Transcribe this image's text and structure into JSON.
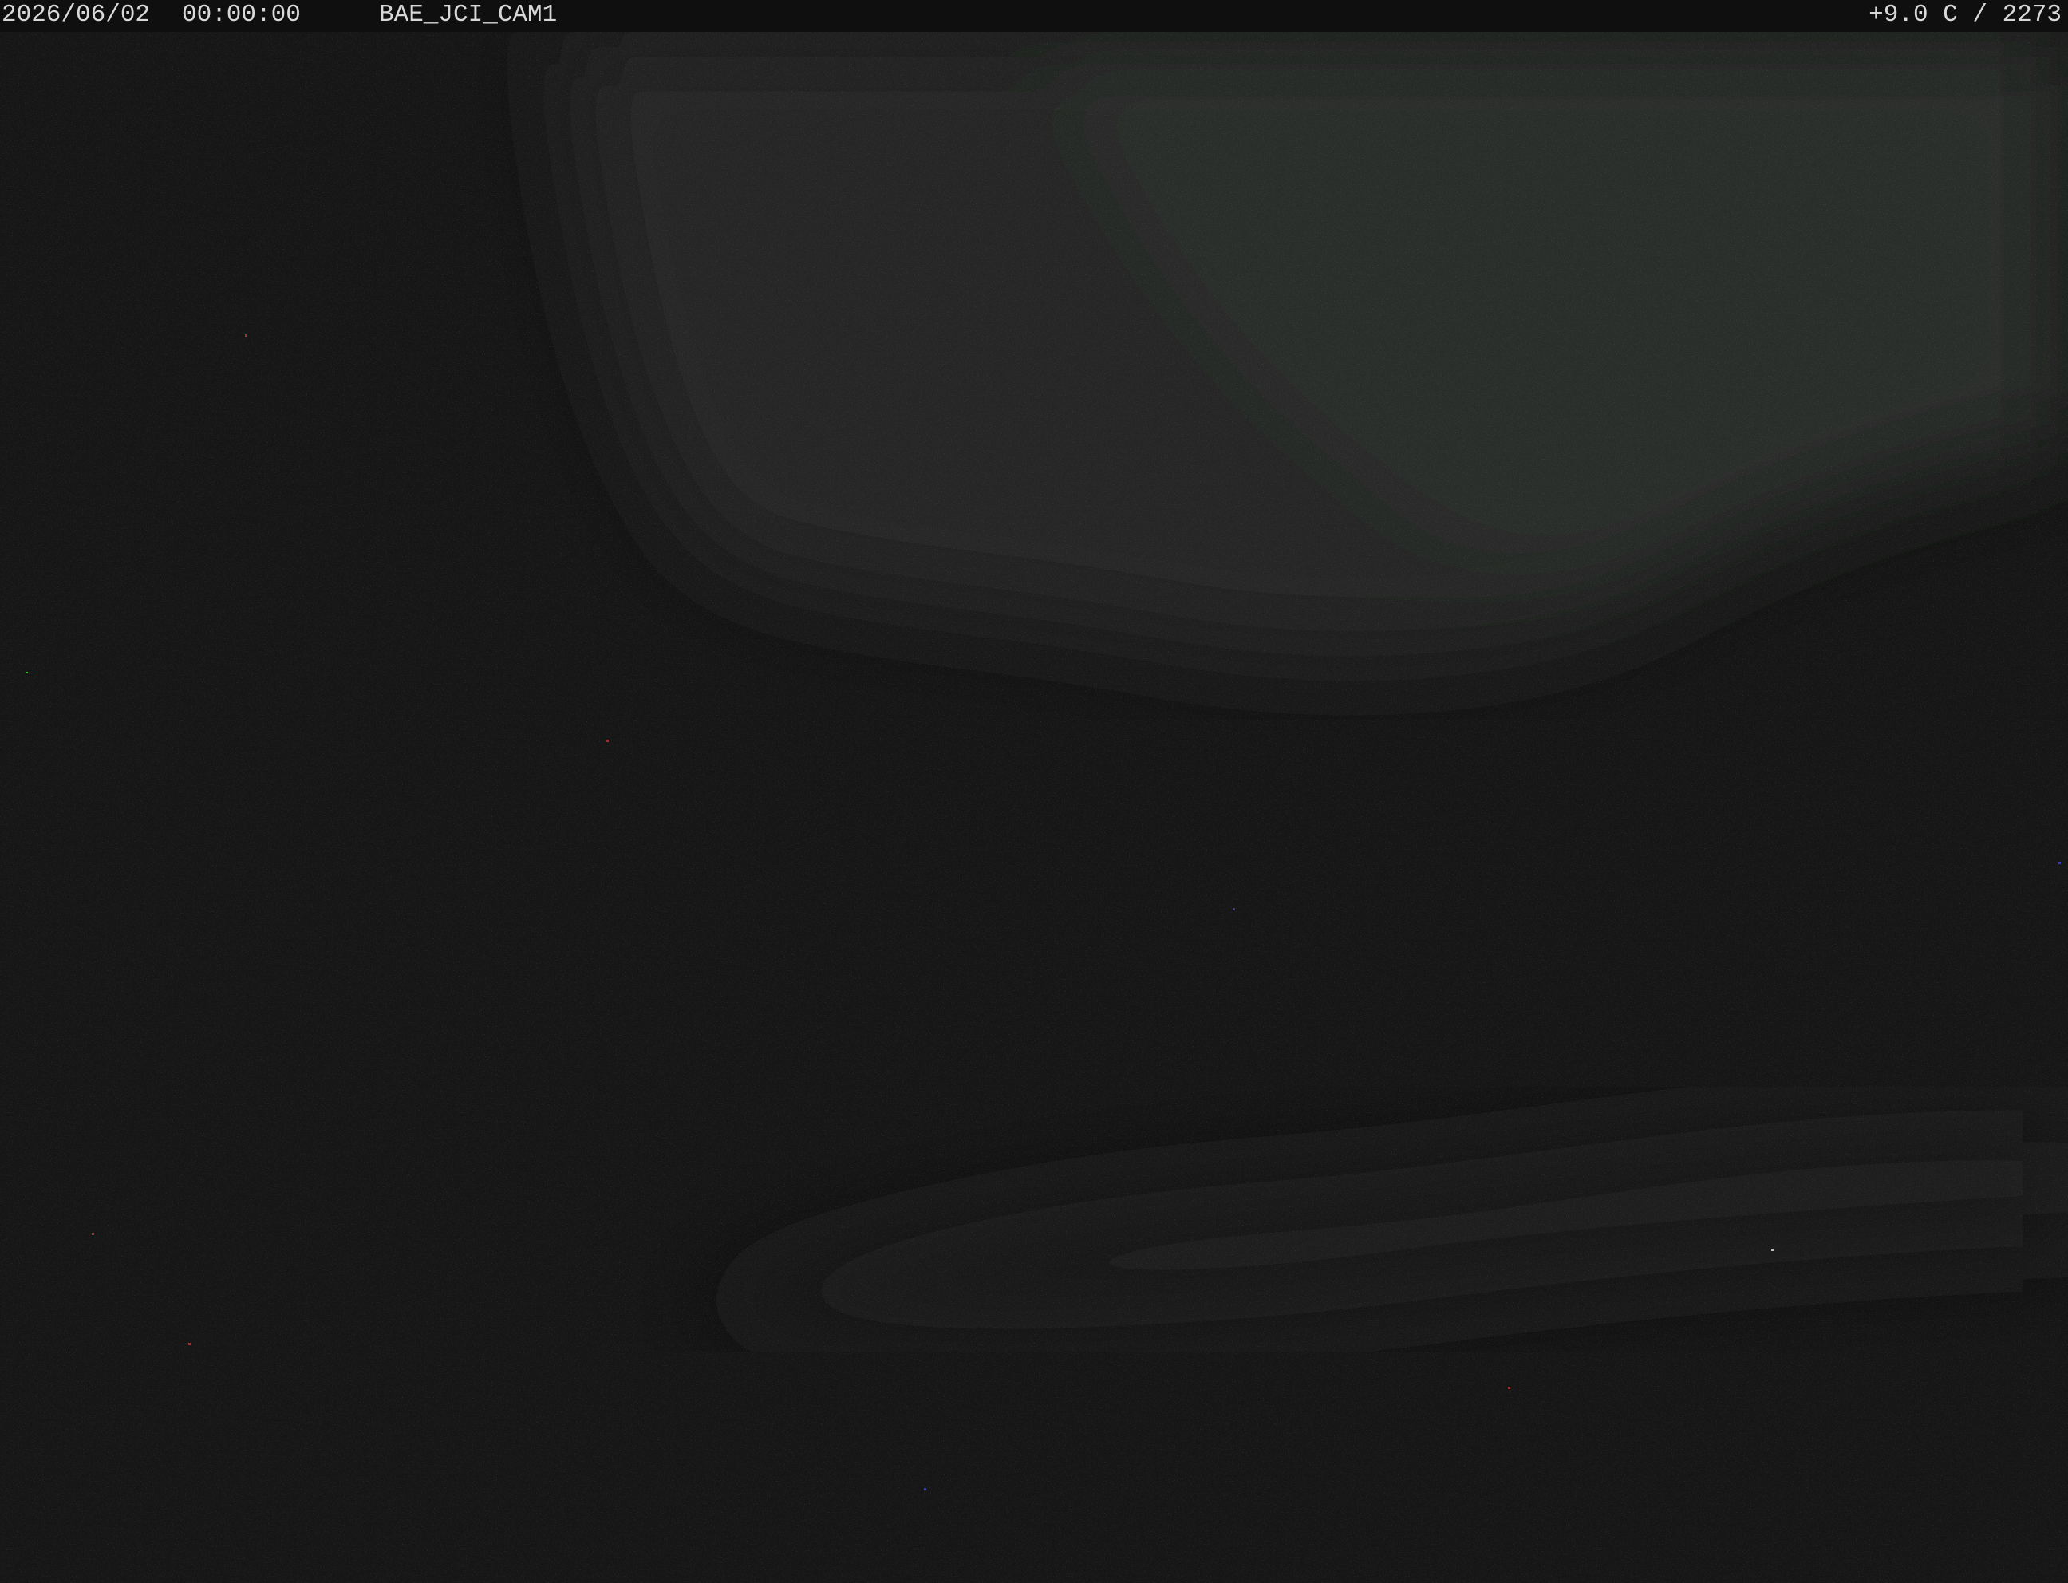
{
  "overlay": {
    "date": "2026/06/02",
    "time": "00:00:00",
    "camera_name": "BAE_JCI_CAM1",
    "telemetry": "+9.0 C / 2273"
  },
  "scene": {
    "description_colors": {
      "background": "#161616",
      "sky_haze": "#2a2c28",
      "ground": "#151515"
    }
  }
}
